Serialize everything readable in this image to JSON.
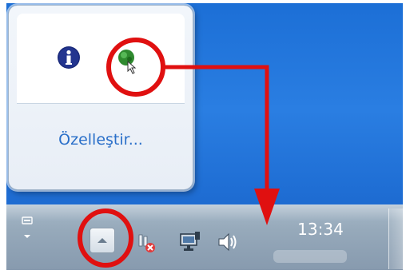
{
  "popup": {
    "customize_label": "Özelleştir...",
    "icons": [
      "info-icon",
      "hidden-app-icon"
    ]
  },
  "taskbar": {
    "clock_time": "13:34",
    "show_hidden_icons": "chevron-up-icon",
    "tray_icons": [
      "network-error-icon",
      "network-icon",
      "volume-icon"
    ]
  },
  "colors": {
    "desktop": "#1c6fd6",
    "link": "#2a6fc9",
    "annotation": "#e01010"
  }
}
